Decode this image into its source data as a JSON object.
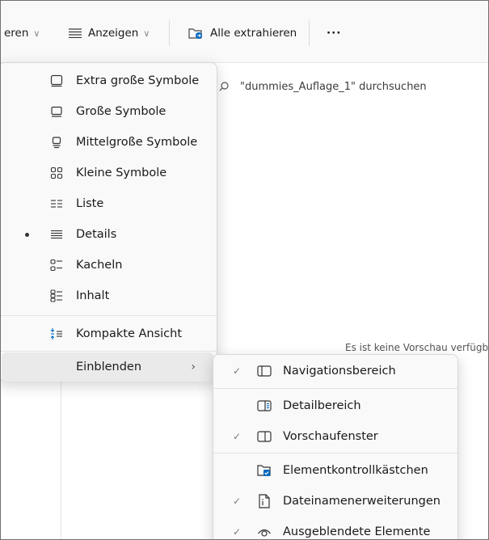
{
  "toolbar": {
    "cut_label": "eren",
    "view_label": "Anzeigen",
    "extract_label": "Alle extrahieren",
    "more_label": "···"
  },
  "search": {
    "placeholder": "\"dummies_Auflage_1\" durchsuchen"
  },
  "preview": {
    "message": "Es ist keine Vorschau verfügb"
  },
  "view_menu": {
    "items": [
      {
        "label": "Extra große Symbole",
        "icon": "extra-large-icons-icon"
      },
      {
        "label": "Große Symbole",
        "icon": "large-icons-icon"
      },
      {
        "label": "Mittelgroße Symbole",
        "icon": "medium-icons-icon"
      },
      {
        "label": "Kleine Symbole",
        "icon": "small-icons-icon"
      },
      {
        "label": "Liste",
        "icon": "list-icon"
      },
      {
        "label": "Details",
        "icon": "details-icon",
        "selected": true
      },
      {
        "label": "Kacheln",
        "icon": "tiles-icon"
      },
      {
        "label": "Inhalt",
        "icon": "content-icon"
      }
    ],
    "compact_label": "Kompakte Ansicht",
    "show_label": "Einblenden",
    "show_arrow": "›"
  },
  "show_menu": {
    "items": [
      {
        "label": "Navigationsbereich",
        "checked": true,
        "icon": "navigation-pane-icon"
      },
      {
        "label": "Detailbereich",
        "checked": false,
        "icon": "details-pane-icon"
      },
      {
        "label": "Vorschaufenster",
        "checked": true,
        "icon": "preview-pane-icon"
      },
      {
        "label": "Elementkontrollkästchen",
        "checked": false,
        "icon": "item-checkboxes-icon"
      },
      {
        "label": "Dateinamenerweiterungen",
        "checked": true,
        "icon": "file-extensions-icon"
      },
      {
        "label": "Ausgeblendete Elemente",
        "checked": true,
        "icon": "hidden-items-icon"
      }
    ],
    "check_glyph": "✓"
  },
  "colors": {
    "accent": "#0067c0",
    "menu_bg": "#f9f9f9",
    "hover": "#eaeaea"
  }
}
